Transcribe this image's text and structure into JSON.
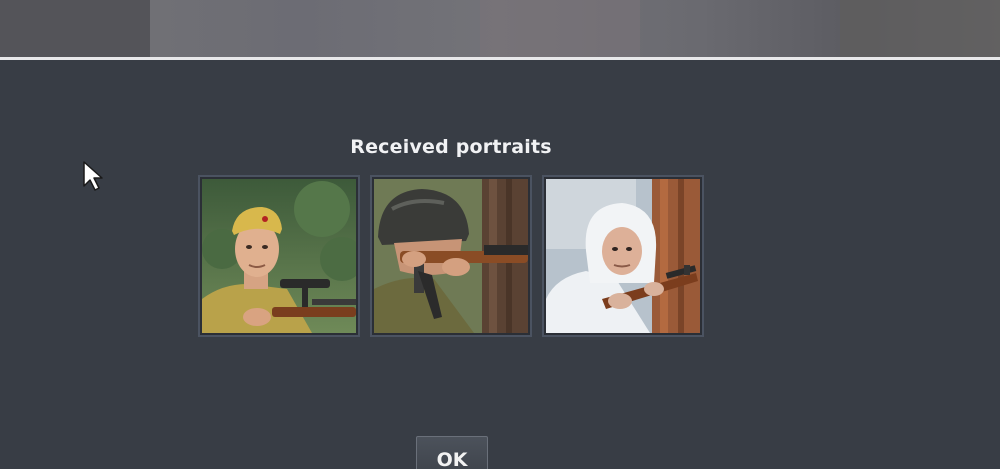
{
  "dialog": {
    "title": "Received portraits",
    "ok_label": "OK"
  },
  "portraits": [
    {
      "icon": "soviet-sniper-portrait"
    },
    {
      "icon": "german-rifleman-portrait"
    },
    {
      "icon": "winter-sniper-portrait"
    }
  ]
}
